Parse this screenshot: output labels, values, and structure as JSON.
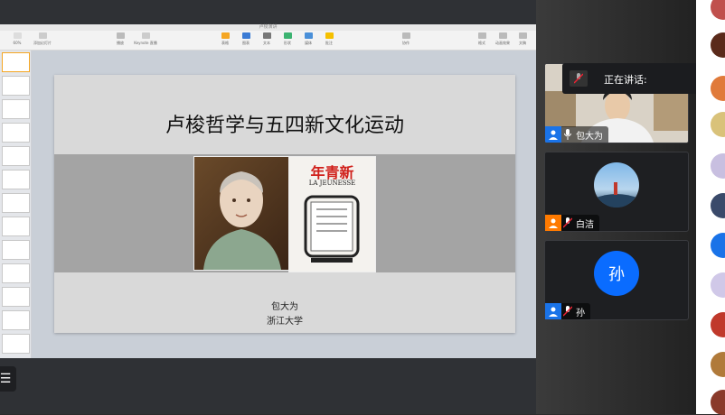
{
  "keynote": {
    "file_title": "卢梭演讲",
    "zoom": "60%",
    "toolbar": [
      "显示",
      "添加幻灯片",
      "播放",
      "Keynote 直播",
      "表格",
      "图表",
      "文本",
      "形状",
      "媒体",
      "批注",
      "协作",
      "格式",
      "动画效果",
      "文稿"
    ],
    "colors": {
      "accent_orange": "#f5a623"
    }
  },
  "slide": {
    "title": "卢梭哲学与五四新文化运动",
    "cover_masthead": "年青新",
    "cover_subtitle": "LA JEUNESSE",
    "author": "包大为",
    "university": "浙江大学"
  },
  "meeting": {
    "speaking_label": "正在讲话:",
    "participants": [
      {
        "name": "包大为",
        "has_video": true,
        "mic": "on"
      },
      {
        "name": "白洁",
        "has_video": false,
        "mic": "muted"
      },
      {
        "name": "孙",
        "initial": "孙",
        "has_video": false,
        "mic": "muted"
      }
    ],
    "menu_icon": "hamburger-icon",
    "colors": {
      "user_icon_orange": "#ff7a00",
      "user_icon_blue": "#1a73e8",
      "initial_avatar_blue": "#0a6cff"
    }
  }
}
